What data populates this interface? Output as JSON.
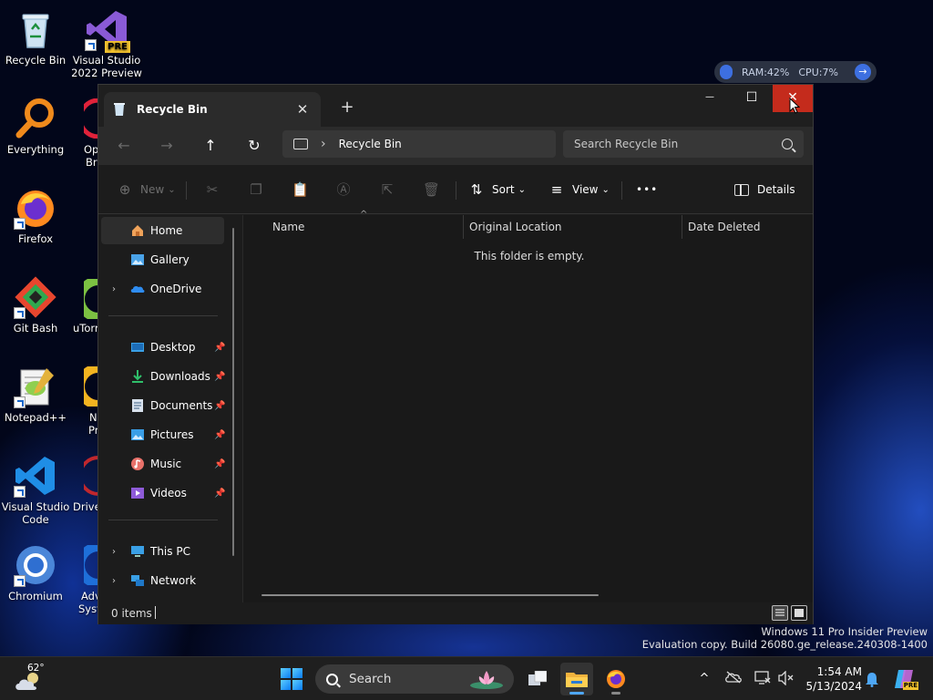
{
  "desktop": {
    "icons": [
      {
        "label": "Recycle Bin"
      },
      {
        "label": "Visual Studio 2022 Preview"
      },
      {
        "label": "Everything"
      },
      {
        "label": "Firefox"
      },
      {
        "label": "Git Bash"
      },
      {
        "label": "Notepad++"
      },
      {
        "label": "Visual Studio Code"
      },
      {
        "label": "Chromium"
      }
    ],
    "partial_labels": [
      "Op",
      "Br",
      "uTorr",
      "N",
      "Pr",
      "Drive",
      "Adv",
      "Syst"
    ],
    "vs_badge": "PRE",
    "perf_widget": {
      "ram": "RAM:42%",
      "cpu": "CPU:7%",
      "arrow": "→"
    },
    "watermark": {
      "line1": "Windows 11 Pro Insider Preview",
      "line2": "Evaluation copy. Build 26080.ge_release.240308-1400"
    }
  },
  "window": {
    "tab_title": "Recycle Bin",
    "tab_close": "✕",
    "new_tab": "+",
    "controls": {
      "minimize": "—",
      "maximize": "☐",
      "close": "✕"
    },
    "nav": {
      "back": "←",
      "forward": "→",
      "up": "↑",
      "refresh": "↻"
    },
    "address": {
      "chevron": "›",
      "location": "Recycle Bin"
    },
    "search": {
      "placeholder": "Search Recycle Bin"
    },
    "commands": {
      "new": "New",
      "new_icon": "⊕",
      "new_chevron": "⌄",
      "sort": "Sort",
      "sort_icon": "⇅",
      "sort_chevron": "⌄",
      "view": "View",
      "view_icon": "≡",
      "view_chevron": "⌄",
      "more": "•••",
      "details": "Details"
    },
    "nav_pane": {
      "items": [
        {
          "label": "Home"
        },
        {
          "label": "Gallery"
        },
        {
          "label": "OneDrive"
        },
        {
          "label": "Desktop"
        },
        {
          "label": "Downloads"
        },
        {
          "label": "Documents"
        },
        {
          "label": "Pictures"
        },
        {
          "label": "Music"
        },
        {
          "label": "Videos"
        },
        {
          "label": "This PC"
        },
        {
          "label": "Network"
        }
      ],
      "expander": "›",
      "pin": "📌"
    },
    "content": {
      "columns": [
        "Name",
        "Original Location",
        "Date Deleted"
      ],
      "sort_indicator": "^",
      "empty_message": "This folder is empty."
    },
    "status": {
      "item_count": "0 items"
    }
  },
  "taskbar": {
    "weather_temp": "62°",
    "search_label": "Search",
    "tray_chevron": "^",
    "clock_time": "1:54 AM",
    "clock_date": "5/13/2024",
    "copilot_badge": "PRE"
  },
  "colors": {
    "accent": "#4ea7f5",
    "close_red": "#c42b1c",
    "window_bg": "#1c1c1c"
  }
}
